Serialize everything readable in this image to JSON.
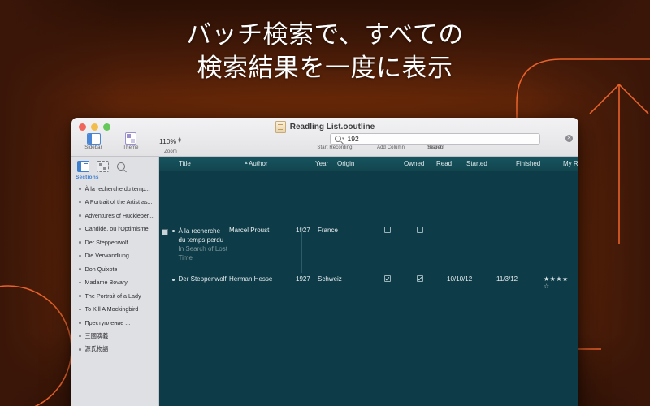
{
  "headline": {
    "line1": "バッチ検索で、すべての",
    "line2": "検索結果を一度に表示"
  },
  "colors": {
    "accent_orange": "#e8622a",
    "background_brown": "#6b2a07",
    "table_bg": "#0d3b47",
    "sidebar_bg": "#dfe0e4"
  },
  "window": {
    "title": "Readling List.ooutline",
    "doc_icon": "document-icon",
    "traffic_lights": [
      "close",
      "minimize",
      "zoom"
    ]
  },
  "toolbar": {
    "sidebar_label": "Sidebar",
    "theme_label": "Theme",
    "zoom_label": "Zoom",
    "zoom_value": "110%",
    "start_recording_label": "Start Recording",
    "add_column_label": "Add Column",
    "inspect_label": "Inspect",
    "search_label": "Search",
    "search_value": "192",
    "clear_glyph": "✕"
  },
  "sidebar": {
    "header": "Sections",
    "tools": [
      "outline-view-icon",
      "grid-view-icon",
      "search-view-icon"
    ],
    "items": [
      {
        "label": "À la recherche du temp..."
      },
      {
        "label": "A Portrait of the Artist as..."
      },
      {
        "label": "Adventures of Huckleber..."
      },
      {
        "label": "Candide, ou l'Optimisme"
      },
      {
        "label": "Der Steppenwolf"
      },
      {
        "label": "Die Verwandlung"
      },
      {
        "label": "Don Quixote"
      },
      {
        "label": "Madame Bovary"
      },
      {
        "label": "The Portrait of a Lady"
      },
      {
        "label": "To Kill A Mockingbird"
      },
      {
        "label": "Преступление ..."
      },
      {
        "label": "三國演義"
      },
      {
        "label": "源氏物語"
      }
    ]
  },
  "table": {
    "columns": [
      {
        "label": "Title"
      },
      {
        "label": "Author"
      },
      {
        "label": "Year"
      },
      {
        "label": "Origin"
      },
      {
        "label": "Owned"
      },
      {
        "label": "Read"
      },
      {
        "label": "Started"
      },
      {
        "label": "Finished"
      },
      {
        "label": "My Rating"
      }
    ],
    "sort_indicator": "▲",
    "rows": [
      {
        "title": "À la recherche du temps perdu",
        "subtitle": "In Search of Lost Time",
        "author": "Marcel Proust",
        "year": "1927",
        "origin": "France",
        "owned": false,
        "read": false,
        "started": "",
        "finished": "",
        "rating_filled": 0,
        "rating_empty": 0,
        "selected": true
      },
      {
        "title": "Der Steppenwolf",
        "subtitle": "",
        "author": "Herman Hesse",
        "year": "1927",
        "origin": "Schweiz",
        "owned": true,
        "read": true,
        "started": "10/10/12",
        "finished": "11/3/12",
        "rating_filled": 4,
        "rating_empty": 1,
        "selected": false
      }
    ]
  }
}
